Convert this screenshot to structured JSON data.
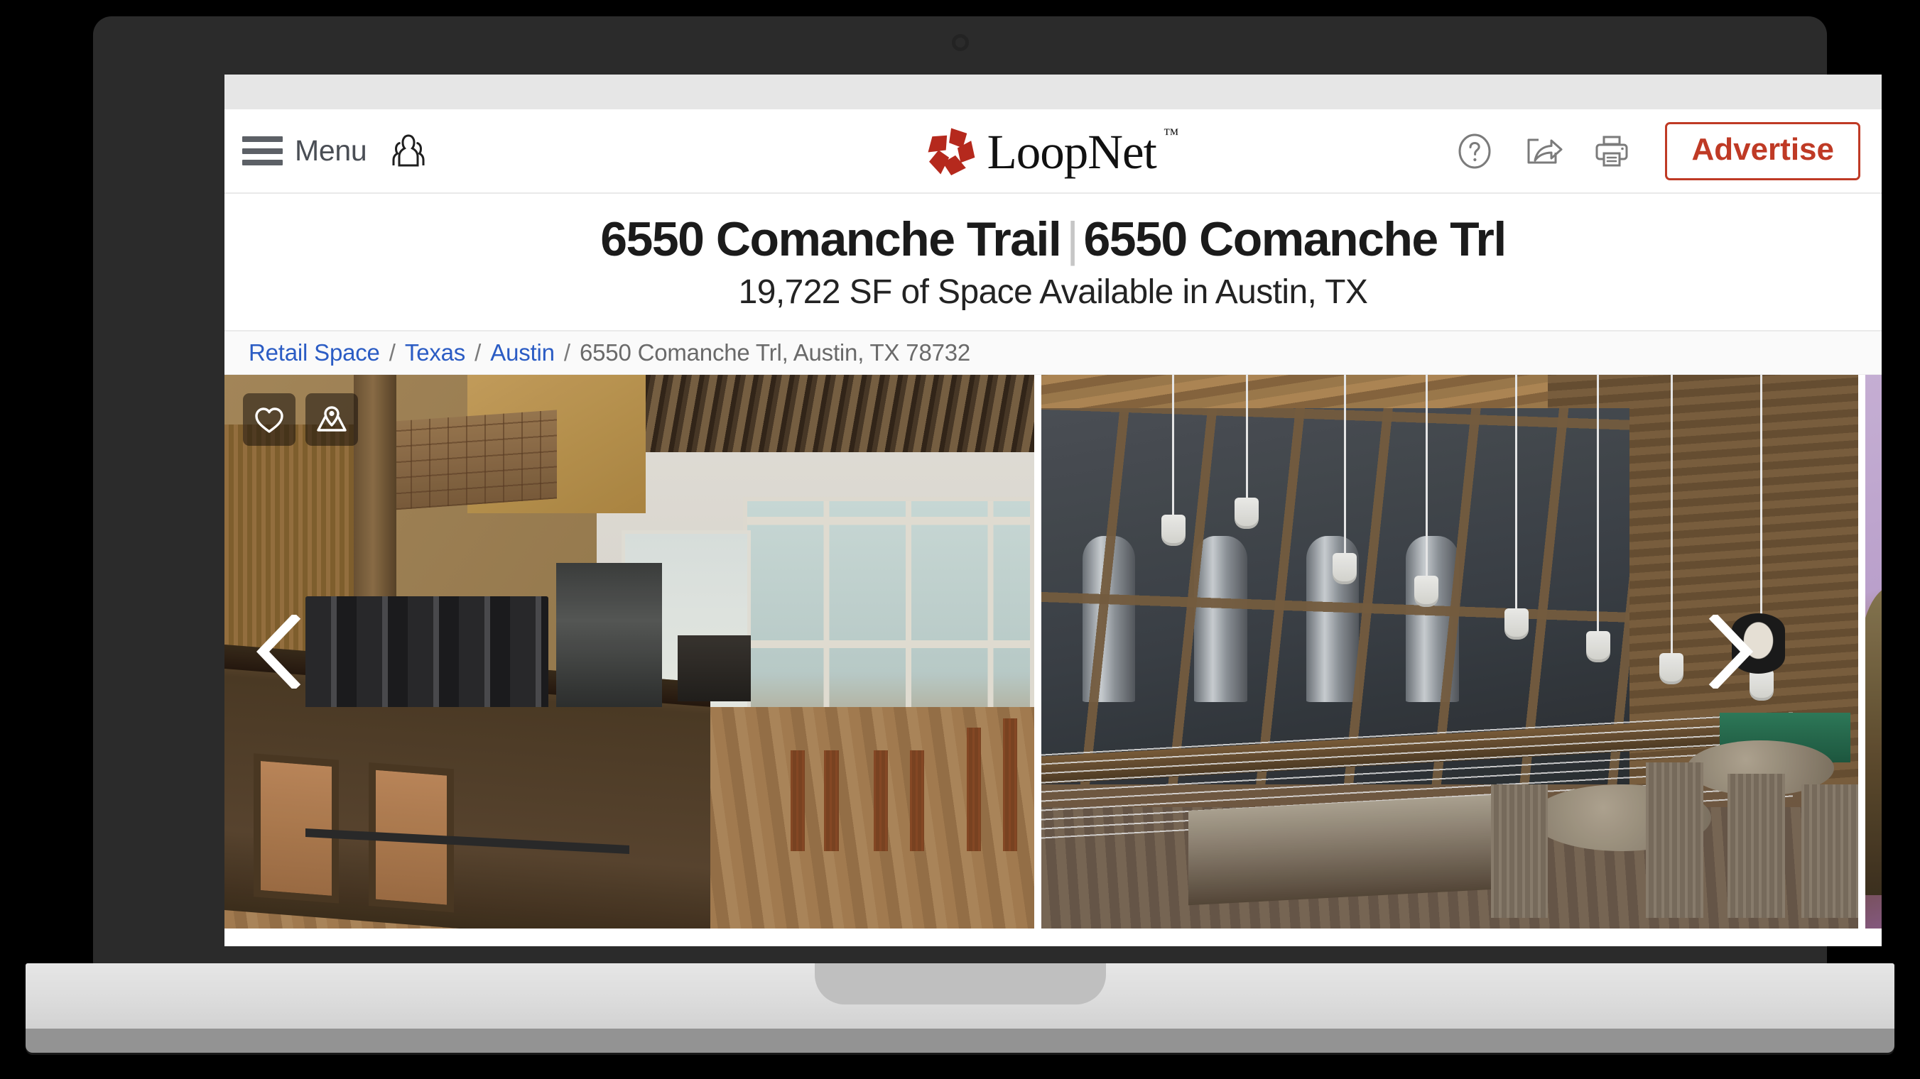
{
  "browser": {
    "strip_color": "#e6e6e6"
  },
  "header": {
    "menu_label": "Menu",
    "contacts_icon": "contacts-people-icon",
    "logo": {
      "mark": "loopnet-pinwheel-icon",
      "wordmark": "LoopNet",
      "trademark": "™",
      "brand_color": "#b5291d"
    },
    "actions": [
      {
        "name": "help-icon",
        "label": "?"
      },
      {
        "name": "share-icon",
        "label": "Share"
      },
      {
        "name": "print-icon",
        "label": "Print"
      }
    ],
    "advertise_label": "Advertise",
    "advertise_color": "#bf3a25"
  },
  "title_section": {
    "name": "6550 Comanche Trail",
    "separator": "|",
    "address_short": "6550 Comanche Trl",
    "subtitle": "19,722 SF of Space Available in Austin, TX"
  },
  "breadcrumb": {
    "links": [
      {
        "label": "Retail Space"
      },
      {
        "label": "Texas"
      },
      {
        "label": "Austin"
      }
    ],
    "separator": "/",
    "current": "6550 Comanche Trl, Austin, TX 78732",
    "link_color": "#2b5cc4",
    "current_color": "#6a6a6a"
  },
  "gallery": {
    "favorite_icon": "heart-icon",
    "map_icon": "map-pin-icon",
    "prev_icon": "chevron-left-icon",
    "next_icon": "chevron-right-icon",
    "photos": [
      {
        "name": "photo-coffee-bar-interior"
      },
      {
        "name": "photo-brewery-taproom-interior"
      },
      {
        "name": "photo-partial-next"
      }
    ]
  }
}
